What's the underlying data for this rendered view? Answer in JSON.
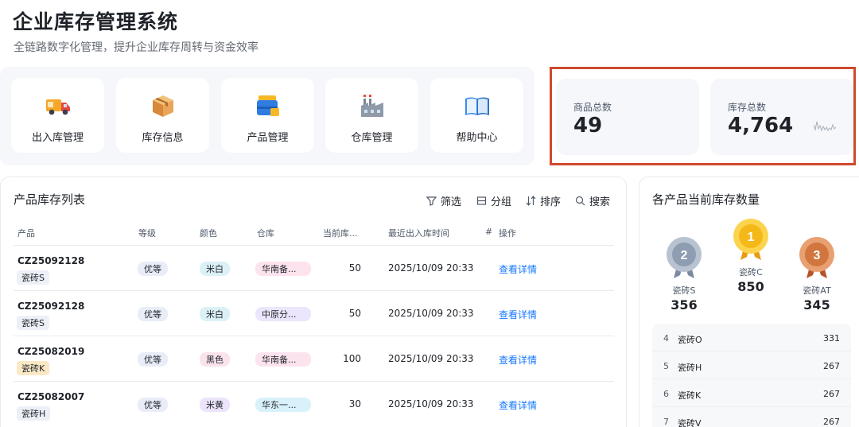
{
  "header": {
    "title": "企业库存管理系统",
    "subtitle": "全链路数字化管理，提升企业库存周转与资金效率"
  },
  "nav": [
    {
      "label": "出入库管理",
      "icon": "truck-icon"
    },
    {
      "label": "库存信息",
      "icon": "box-icon"
    },
    {
      "label": "产品管理",
      "icon": "cart-icon"
    },
    {
      "label": "仓库管理",
      "icon": "factory-icon"
    },
    {
      "label": "帮助中心",
      "icon": "book-icon"
    }
  ],
  "stats": {
    "products": {
      "label": "商品总数",
      "value": "49"
    },
    "inventory": {
      "label": "库存总数",
      "value": "4,764"
    }
  },
  "list": {
    "title": "产品库存列表",
    "tools": {
      "filter": "筛选",
      "group": "分组",
      "sort": "排序",
      "search": "搜索"
    },
    "columns": {
      "product": "产品",
      "grade": "等级",
      "color": "颜色",
      "warehouse": "仓库",
      "qty": "当前库...",
      "date": "最近出入库时间",
      "hash": "#",
      "action": "操作"
    },
    "rows": [
      {
        "code": "CZ25092128",
        "sub": "瓷砖S",
        "grade": "优等",
        "color": "米白",
        "warehouse": "华南备...",
        "qty": "50",
        "date": "2025/10/09 20:33",
        "action": "查看详情"
      },
      {
        "code": "CZ25092128",
        "sub": "瓷砖S",
        "grade": "优等",
        "color": "米白",
        "warehouse": "中原分...",
        "qty": "50",
        "date": "2025/10/09 20:33",
        "action": "查看详情"
      },
      {
        "code": "CZ25082019",
        "sub": "瓷砖K",
        "grade": "优等",
        "color": "黑色",
        "warehouse": "华南备...",
        "qty": "100",
        "date": "2025/10/09 20:33",
        "action": "查看详情"
      },
      {
        "code": "CZ25082007",
        "sub": "瓷砖H",
        "grade": "优等",
        "color": "米黄",
        "warehouse": "华东一...",
        "qty": "30",
        "date": "2025/10/09 20:33",
        "action": "查看详情"
      }
    ]
  },
  "ranking": {
    "title": "各产品当前库存数量",
    "podium": [
      {
        "rank": "2",
        "name": "瓷砖S",
        "value": "356"
      },
      {
        "rank": "1",
        "name": "瓷砖C",
        "value": "850"
      },
      {
        "rank": "3",
        "name": "瓷砖AT",
        "value": "345"
      }
    ],
    "rows": [
      {
        "rank": "4",
        "name": "瓷砖O",
        "value": "331"
      },
      {
        "rank": "5",
        "name": "瓷砖H",
        "value": "267"
      },
      {
        "rank": "6",
        "name": "瓷砖K",
        "value": "267"
      },
      {
        "rank": "7",
        "name": "瓷砖V",
        "value": "267"
      }
    ]
  },
  "colors": {
    "accent": "#1677ff",
    "highlight_border": "#cf4a2e",
    "pill_white": "#dcf1f5",
    "pill_black": "#fbe3ec",
    "pill_yellow": "#ebe4fa",
    "wh_south": "#fde3ee",
    "wh_central": "#ebe6fb",
    "wh_east": "#d9f1fb"
  }
}
